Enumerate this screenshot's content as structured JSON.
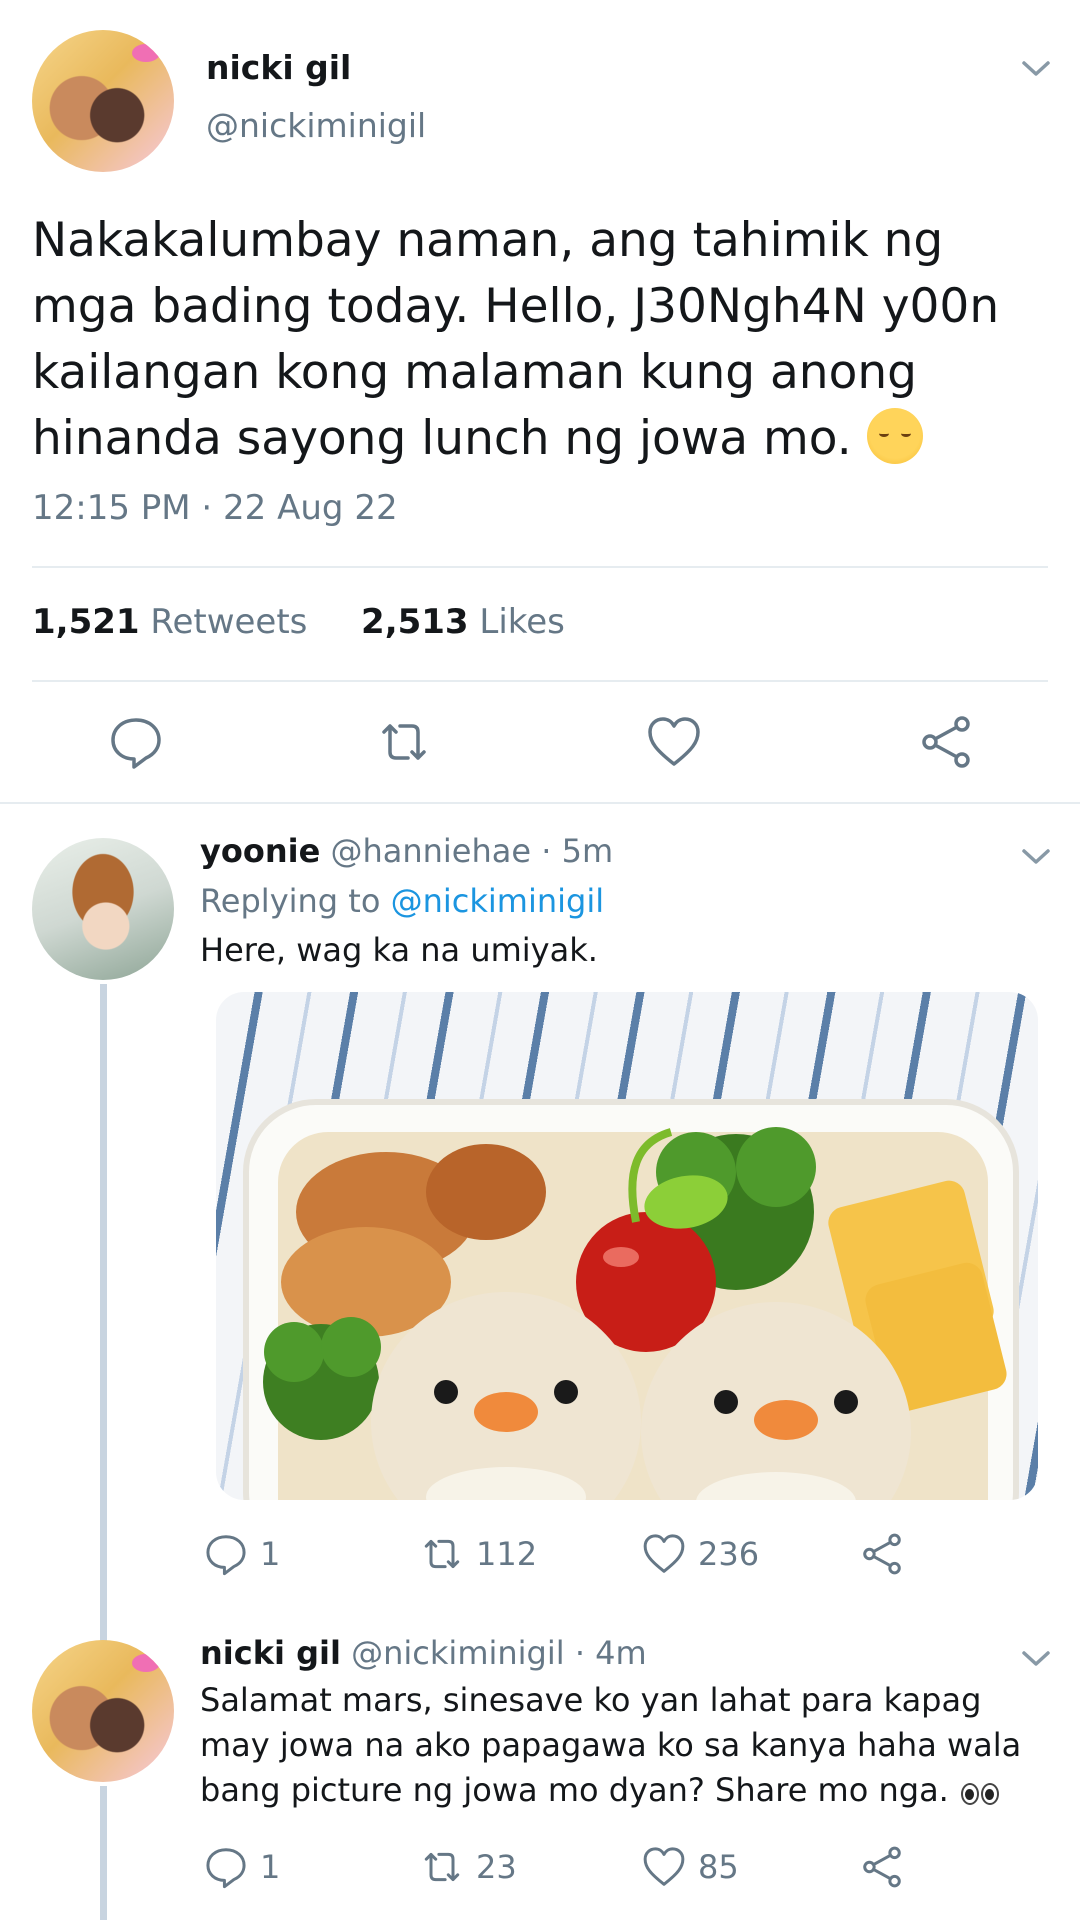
{
  "main_tweet": {
    "display_name": "nicki gil",
    "handle": "@nickiminigil",
    "text": "Nakakalumbay naman, ang tahimik ng mga bading today. Hello, J30Ngh4N y00n kailangan kong malaman kung anong hinanda sayong lunch ng jowa mo.",
    "emoji": "pensive-face",
    "timestamp": "12:15 PM · 22 Aug 22",
    "retweets_count": "1,521",
    "retweets_label": "Retweets",
    "likes_count": "2,513",
    "likes_label": "Likes",
    "actions": [
      "reply-icon",
      "retweet-icon",
      "like-icon",
      "share-icon"
    ]
  },
  "replies": [
    {
      "display_name": "yoonie",
      "handle_time": "@hanniehae · 5m",
      "replying_to_label": "Replying to",
      "replying_to_handle": "@nickiminigil",
      "text": "Here, wag ka na umiyak.",
      "image": "bento lunch box with rice chicks, tomato, broccoli, egg",
      "reply_count": "1",
      "retweet_count": "112",
      "like_count": "236"
    },
    {
      "display_name": "nicki gil",
      "handle_time": "@nickiminigil · 4m",
      "text": "Salamat mars, sinesave ko yan lahat para kapag may jowa na ako papagawa ko sa kanya haha wala bang picture ng jowa mo dyan? Share mo nga.",
      "emoji": "eyes",
      "reply_count": "1",
      "retweet_count": "23",
      "like_count": "85"
    }
  ],
  "colors": {
    "text": "#14171a",
    "muted": "#657786",
    "link": "#1b95e0",
    "divider": "#e6ecf0",
    "thread_line": "#c8d4e0"
  }
}
